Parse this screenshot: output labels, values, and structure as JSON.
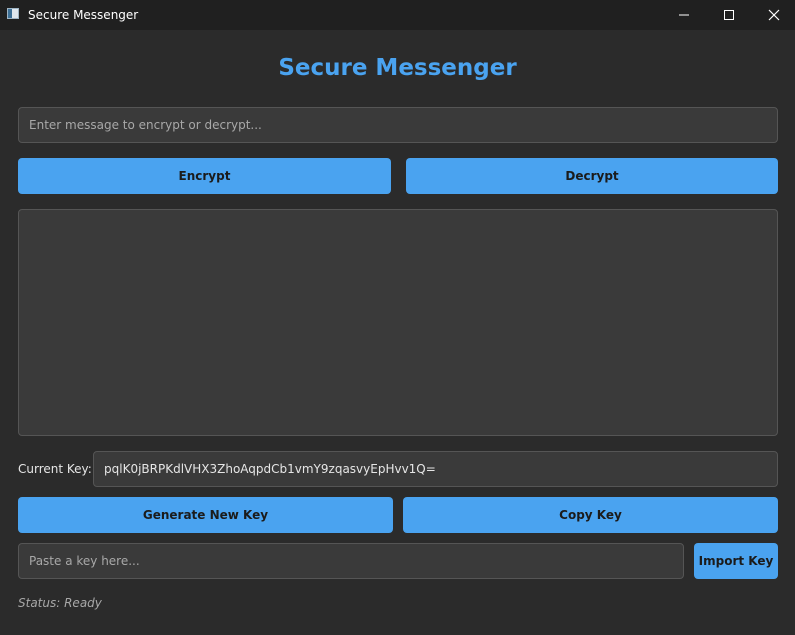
{
  "window": {
    "title": "Secure Messenger",
    "controls": {
      "minimize_icon": "minimize-icon",
      "maximize_icon": "maximize-icon",
      "close_icon": "close-icon"
    }
  },
  "header": {
    "title": "Secure Messenger"
  },
  "message": {
    "value": "",
    "placeholder": "Enter message to encrypt or decrypt..."
  },
  "actions": {
    "encrypt_label": "Encrypt",
    "decrypt_label": "Decrypt"
  },
  "output": {
    "value": ""
  },
  "key": {
    "label": "Current Key:",
    "value": "pqlK0jBRPKdlVHX3ZhoAqpdCb1vmY9zqasvyEpHvv1Q=",
    "generate_label": "Generate New Key",
    "copy_label": "Copy Key"
  },
  "import": {
    "value": "",
    "placeholder": "Paste a key here...",
    "button_label": "Import Key"
  },
  "status": {
    "text": "Status: Ready"
  },
  "colors": {
    "background": "#2b2b2b",
    "titlebar": "#202020",
    "accent": "#4aa3f0",
    "field": "#3a3a3a",
    "field_border": "#555555",
    "text": "#e6e6e6",
    "muted_text": "#a8a8a8"
  }
}
